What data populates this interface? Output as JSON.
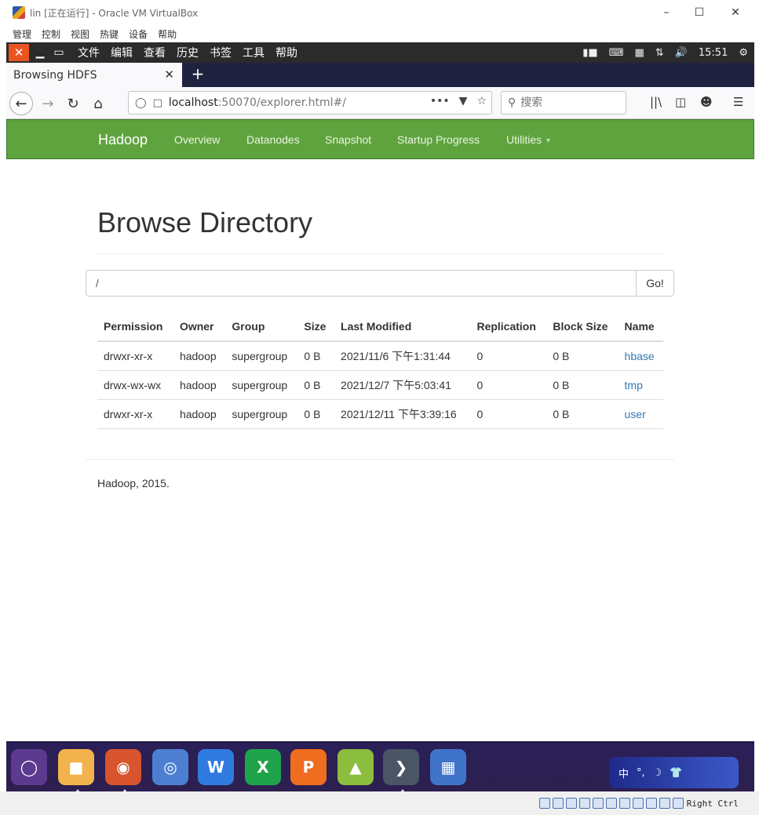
{
  "vbox": {
    "title": "lin [正在运行] - Oracle VM VirtualBox",
    "menu": [
      "管理",
      "控制",
      "视图",
      "热键",
      "设备",
      "帮助"
    ],
    "host_key": "Right Ctrl"
  },
  "guest_panel": {
    "menu": [
      "文件",
      "编辑",
      "查看",
      "历史",
      "书签",
      "工具",
      "帮助"
    ],
    "clock": "15:51"
  },
  "browser": {
    "tab_title": "Browsing HDFS",
    "url_host": "localhost",
    "url_path": ":50070/explorer.html#/",
    "search_placeholder": "搜索"
  },
  "navbar": {
    "brand": "Hadoop",
    "links": [
      "Overview",
      "Datanodes",
      "Snapshot",
      "Startup Progress",
      "Utilities"
    ]
  },
  "page": {
    "title": "Browse Directory",
    "path_value": "/",
    "go_label": "Go!",
    "footer": "Hadoop, 2015."
  },
  "table": {
    "headers": [
      "Permission",
      "Owner",
      "Group",
      "Size",
      "Last Modified",
      "Replication",
      "Block Size",
      "Name"
    ],
    "rows": [
      [
        "drwxr-xr-x",
        "hadoop",
        "supergroup",
        "0 B",
        "2021/11/6 下午1:31:44",
        "0",
        "0 B",
        "hbase"
      ],
      [
        "drwx-wx-wx",
        "hadoop",
        "supergroup",
        "0 B",
        "2021/12/7 下午5:03:41",
        "0",
        "0 B",
        "tmp"
      ],
      [
        "drwxr-xr-x",
        "hadoop",
        "supergroup",
        "0 B",
        "2021/12/11 下午3:39:16",
        "0",
        "0 B",
        "user"
      ]
    ]
  },
  "dock": {
    "apps": [
      "ubuntu-kylin-icon",
      "files-icon",
      "firefox-icon",
      "chromium-icon",
      "wps-writer-icon",
      "wps-spreadsheet-icon",
      "wps-presentation-icon",
      "software-center-icon",
      "terminal-icon",
      "app-grid-icon"
    ],
    "tray_labels": [
      "中",
      "°,",
      "☽",
      "👕"
    ]
  },
  "colors": {
    "hadoop_green": "#5fa33e",
    "link_blue": "#337ab7",
    "ubuntu_orange": "#e95420"
  }
}
